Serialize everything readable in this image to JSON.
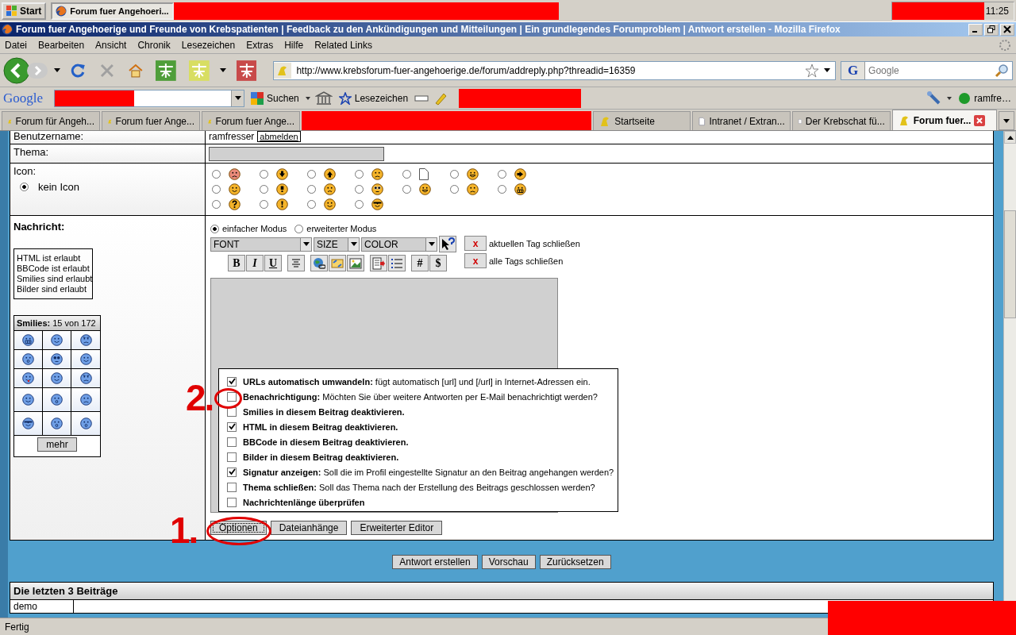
{
  "taskbar": {
    "start": "Start",
    "task": "Forum fuer Angehoeri...",
    "clock": "11:25"
  },
  "window": {
    "title": "Forum fuer Angehoerige und Freunde von Krebspatienten | Feedback zu den Ankündigungen und Mitteilungen | Ein grundlegendes Forumproblem | Antwort erstellen - Mozilla Firefox"
  },
  "menu": [
    "Datei",
    "Bearbeiten",
    "Ansicht",
    "Chronik",
    "Lesezeichen",
    "Extras",
    "Hilfe",
    "Related Links"
  ],
  "navbar": {
    "url": "http://www.krebsforum-fuer-angehoerige.de/forum/addreply.php?threadid=16359",
    "search_engine": "G",
    "search_placeholder": "Google"
  },
  "google_toolbar": {
    "logo": "Google",
    "search_button": "Suchen",
    "bookmarks": "Lesezeichen",
    "account": "ramfre…"
  },
  "tabs_left": [
    {
      "label": "Forum für Angeh...",
      "kind": "forum",
      "selected": false
    },
    {
      "label": "Forum fuer Ange...",
      "kind": "forum",
      "selected": false
    },
    {
      "label": "Forum fuer Ange...",
      "kind": "forum",
      "selected": false
    }
  ],
  "tabs_right": [
    {
      "label": "Startseite",
      "kind": "forum",
      "selected": false
    },
    {
      "label": "Intranet / Extran...",
      "kind": "page",
      "selected": false
    },
    {
      "label": "Der Krebschat fü...",
      "kind": "page",
      "selected": false
    },
    {
      "label": "Forum fuer...",
      "kind": "forum",
      "selected": true
    }
  ],
  "form": {
    "username_label": "Benutzername:",
    "username": "ramfresser",
    "logout": "abmelden",
    "topic_label": "Thema:",
    "icon_label": "Icon:",
    "no_icon": {
      "label": "kein Icon",
      "selected": true
    },
    "icons": [
      {
        "kind": "sad-red",
        "selected": false
      },
      {
        "kind": "arrow-down",
        "selected": false
      },
      {
        "kind": "arrow-up",
        "selected": false
      },
      {
        "kind": "frown",
        "selected": false
      },
      {
        "kind": "document",
        "selected": false
      },
      {
        "kind": "grin",
        "selected": false
      },
      {
        "kind": "arrow-right",
        "selected": false
      },
      {
        "kind": "smile",
        "selected": false
      },
      {
        "kind": "bulb",
        "selected": false
      },
      {
        "kind": "worried",
        "selected": false
      },
      {
        "kind": "eyes",
        "selected": false
      },
      {
        "kind": "grin",
        "selected": false
      },
      {
        "kind": "frown",
        "selected": false
      },
      {
        "kind": "teeth",
        "selected": false
      },
      {
        "kind": "question",
        "selected": false
      },
      {
        "kind": "exclaim",
        "selected": false
      },
      {
        "kind": "smile",
        "selected": false
      },
      {
        "kind": "cool",
        "selected": false
      }
    ],
    "message_label": "Nachricht:",
    "permissions": [
      "HTML ist erlaubt",
      "BBCode ist erlaubt",
      "Smilies sind erlaubt",
      "Bilder sind erlaubt"
    ],
    "smilies_title": "**Smilies:** 15 von 172",
    "smilies": [
      {
        "kind": "teeth"
      },
      {
        "kind": "smile"
      },
      {
        "kind": "angry"
      },
      {
        "kind": "surprised"
      },
      {
        "kind": "eyes"
      },
      {
        "kind": "smile"
      },
      {
        "kind": "tongue"
      },
      {
        "kind": "smile"
      },
      {
        "kind": "angry"
      },
      {
        "kind": "smile"
      },
      {
        "kind": "surprised"
      },
      {
        "kind": "frown"
      },
      {
        "kind": "cool"
      },
      {
        "kind": "surprised"
      },
      {
        "kind": "surprised"
      }
    ],
    "more": "mehr",
    "modes": [
      {
        "label": "einfacher Modus",
        "selected": true
      },
      {
        "label": "erweiterter Modus",
        "selected": false
      }
    ],
    "selects": [
      "FONT",
      "SIZE",
      "COLOR"
    ],
    "format_buttons": [
      "B",
      "I",
      "U"
    ],
    "symbol_buttons": [
      "#",
      "$"
    ],
    "close_buttons": [
      {
        "mark": "x",
        "label": "aktuellen Tag schließen"
      },
      {
        "mark": "x",
        "label": "alle Tags schließen"
      }
    ],
    "options": [
      {
        "text": "**URLs automatisch umwandeln:** fügt automatisch [url] und [/url] in Internet-Adressen ein.",
        "checked": true
      },
      {
        "text": "**Benachrichtigung:** Möchten Sie über weitere Antworten per E-Mail benachrichtigt werden?",
        "checked": false
      },
      {
        "text": "Smilies in diesem Beitrag deaktivieren.",
        "checked": false
      },
      {
        "text": "HTML in diesem Beitrag deaktivieren.",
        "checked": true
      },
      {
        "text": "BBCode in diesem Beitrag deaktivieren.",
        "checked": false
      },
      {
        "text": "Bilder in diesem Beitrag deaktivieren.",
        "checked": false
      },
      {
        "text": "**Signatur anzeigen:** Soll die im Profil eingestellte Signatur an den Beitrag angehangen werden?",
        "checked": true
      },
      {
        "text": "**Thema schließen:** Soll das Thema nach der Erstellung des Beitrags geschlossen werden?",
        "checked": false
      },
      {
        "text": "Nachrichtenlänge überprüfen",
        "checked": false
      }
    ],
    "editor_tabs": [
      {
        "label": "Optionen",
        "focused": true
      },
      {
        "label": "Dateianhänge",
        "focused": false
      },
      {
        "label": "Erweiterter Editor",
        "focused": false
      }
    ]
  },
  "actions": [
    "Antwort erstellen",
    "Vorschau",
    "Zurücksetzen"
  ],
  "recent": {
    "title": "Die letzten 3 Beiträge",
    "rows": [
      {
        "author": "demo"
      }
    ]
  },
  "annotations": [
    "1.",
    "2."
  ],
  "status": "Fertig"
}
